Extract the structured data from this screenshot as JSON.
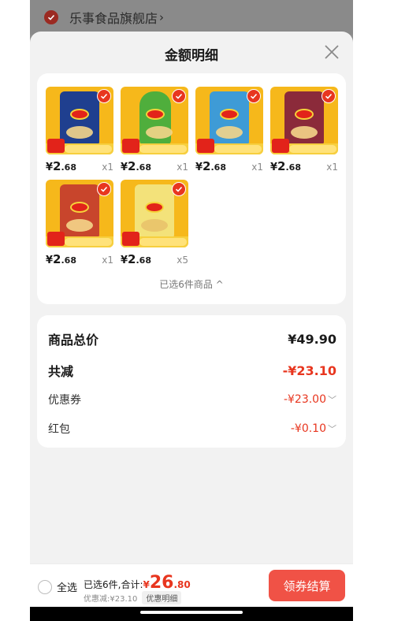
{
  "store": {
    "name": "乐事食品旗舰店",
    "chevron": "›"
  },
  "sheet": {
    "title": "金额明细"
  },
  "products": [
    {
      "price_int": "2",
      "price_dec": ".68",
      "qty": "x1",
      "bag_color": "#1f3f8f",
      "icon": "chips-bag-icon"
    },
    {
      "price_int": "2",
      "price_dec": ".68",
      "qty": "x1",
      "bag_color": "#4fae3c",
      "icon": "chips-canister-icon"
    },
    {
      "price_int": "2",
      "price_dec": ".68",
      "qty": "x1",
      "bag_color": "#3e9bd6",
      "icon": "chips-bag-icon"
    },
    {
      "price_int": "2",
      "price_dec": ".68",
      "qty": "x1",
      "bag_color": "#8b2a3a",
      "icon": "chips-bag-icon"
    },
    {
      "price_int": "2",
      "price_dec": ".68",
      "qty": "x1",
      "bag_color": "#c8452c",
      "icon": "chips-bag-icon"
    },
    {
      "price_int": "2",
      "price_dec": ".68",
      "qty": "x5",
      "bag_color": "#f3e27a",
      "icon": "chips-bag-icon"
    }
  ],
  "currency": "¥",
  "selected_summary": "已选6件商品 ^",
  "totals": {
    "subtotal": {
      "label": "商品总价",
      "value": "¥49.90"
    },
    "reduction": {
      "label": "共减",
      "value": "-¥23.10"
    },
    "coupon": {
      "label": "优惠券",
      "value": "-¥23.00",
      "chevron": "﹀"
    },
    "red_packet": {
      "label": "红包",
      "value": "-¥0.10",
      "chevron": "﹀"
    }
  },
  "bottom_bar": {
    "select_all": "全选",
    "summary_prefix": "已选6件,合计:",
    "total_yen": "¥",
    "total_int": "26",
    "total_dec": ".80",
    "discount_text": "优惠减:¥23.10",
    "detail_label": "优惠明细",
    "checkout_label": "领券结算"
  },
  "colors": {
    "accent": "#e8361f",
    "button": "#f05246",
    "sheet_bg": "#f2f2f2"
  }
}
